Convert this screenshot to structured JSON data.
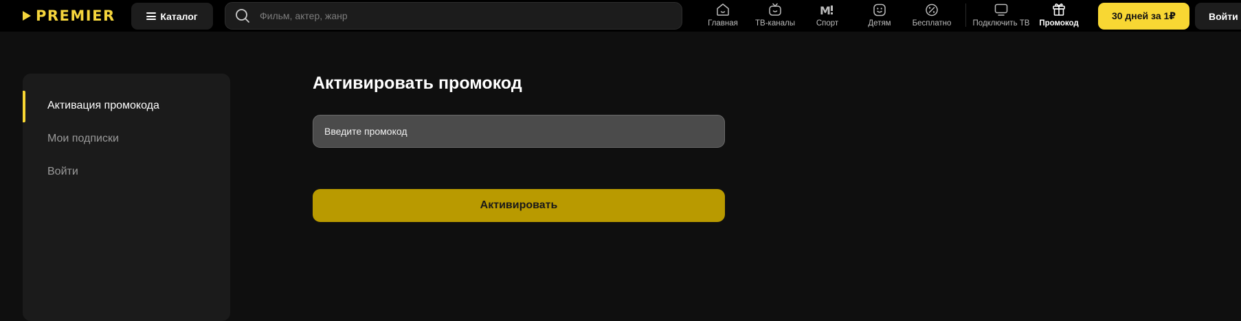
{
  "header": {
    "logo_text": "PREMIER",
    "catalog_label": "Каталог",
    "search_placeholder": "Фильм, актер, жанр",
    "nav": [
      {
        "label": "Главная",
        "icon": "home-icon"
      },
      {
        "label": "ТВ-каналы",
        "icon": "tv-channels-icon"
      },
      {
        "label": "Спорт",
        "icon": "sport-icon"
      },
      {
        "label": "Детям",
        "icon": "kids-icon"
      },
      {
        "label": "Бесплатно",
        "icon": "free-icon"
      },
      {
        "label": "Подключить ТВ",
        "icon": "connect-tv-icon"
      },
      {
        "label": "Промокод",
        "icon": "gift-icon",
        "active": true
      }
    ],
    "trial_label": "30 дней за 1₽",
    "login_label": "Войти"
  },
  "sidebar": {
    "items": [
      {
        "label": "Активация промокода",
        "active": true
      },
      {
        "label": "Мои подписки"
      },
      {
        "label": "Войти"
      }
    ]
  },
  "main": {
    "title": "Активировать промокод",
    "promo_placeholder": "Введите промокод",
    "activate_label": "Активировать"
  },
  "colors": {
    "accent": "#f8d733",
    "activate_button": "#b99a00",
    "background": "#0f0f0f",
    "header": "#000000",
    "sidebar": "#1b1b1b"
  }
}
